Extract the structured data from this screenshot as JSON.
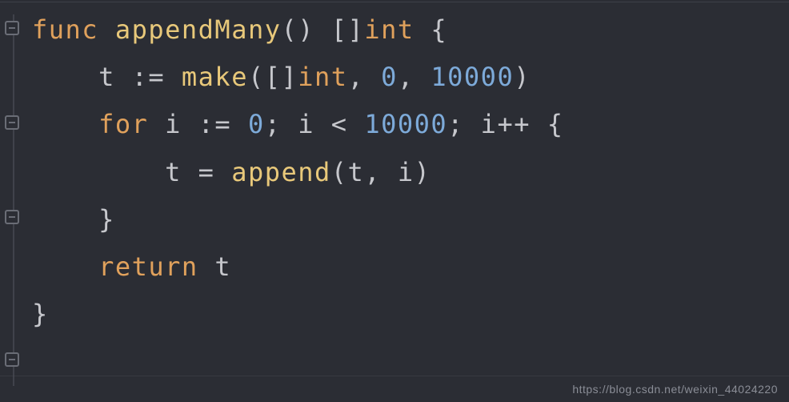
{
  "code": {
    "line1": {
      "kw_func": "func",
      "sp1": " ",
      "fn_name": "appendMany",
      "paren_open": "()",
      "sp2": " ",
      "bracket": "[]",
      "type_int": "int",
      "sp3": " ",
      "brace_open": "{"
    },
    "line2": {
      "indent": "    ",
      "var_t": "t",
      "sp1": " ",
      "op_decl": ":=",
      "sp2": " ",
      "fn_make": "make",
      "paren_open": "(",
      "bracket": "[]",
      "type_int": "int",
      "comma1": ",",
      "sp3": " ",
      "num_0": "0",
      "comma2": ",",
      "sp4": " ",
      "num_10000": "10000",
      "paren_close": ")"
    },
    "line3": {
      "indent": "    ",
      "kw_for": "for",
      "sp1": " ",
      "var_i": "i",
      "sp2": " ",
      "op_decl": ":=",
      "sp3": " ",
      "num_0": "0",
      "semi1": ";",
      "sp4": " ",
      "var_i2": "i",
      "sp5": " ",
      "op_lt": "<",
      "sp6": " ",
      "num_10000": "10000",
      "semi2": ";",
      "sp7": " ",
      "var_i3": "i",
      "op_inc": "++",
      "sp8": " ",
      "brace_open": "{"
    },
    "line4": {
      "indent": "        ",
      "var_t": "t",
      "sp1": " ",
      "op_eq": "=",
      "sp2": " ",
      "fn_append": "append",
      "paren_open": "(",
      "var_t2": "t",
      "comma": ",",
      "sp3": " ",
      "var_i": "i",
      "paren_close": ")"
    },
    "line5": {
      "indent": "    ",
      "brace_close": "}"
    },
    "line6": {
      "indent": "    ",
      "kw_return": "return",
      "sp1": " ",
      "var_t": "t"
    },
    "line7": {
      "brace_close": "}"
    }
  },
  "watermark": "https://blog.csdn.net/weixin_44024220"
}
